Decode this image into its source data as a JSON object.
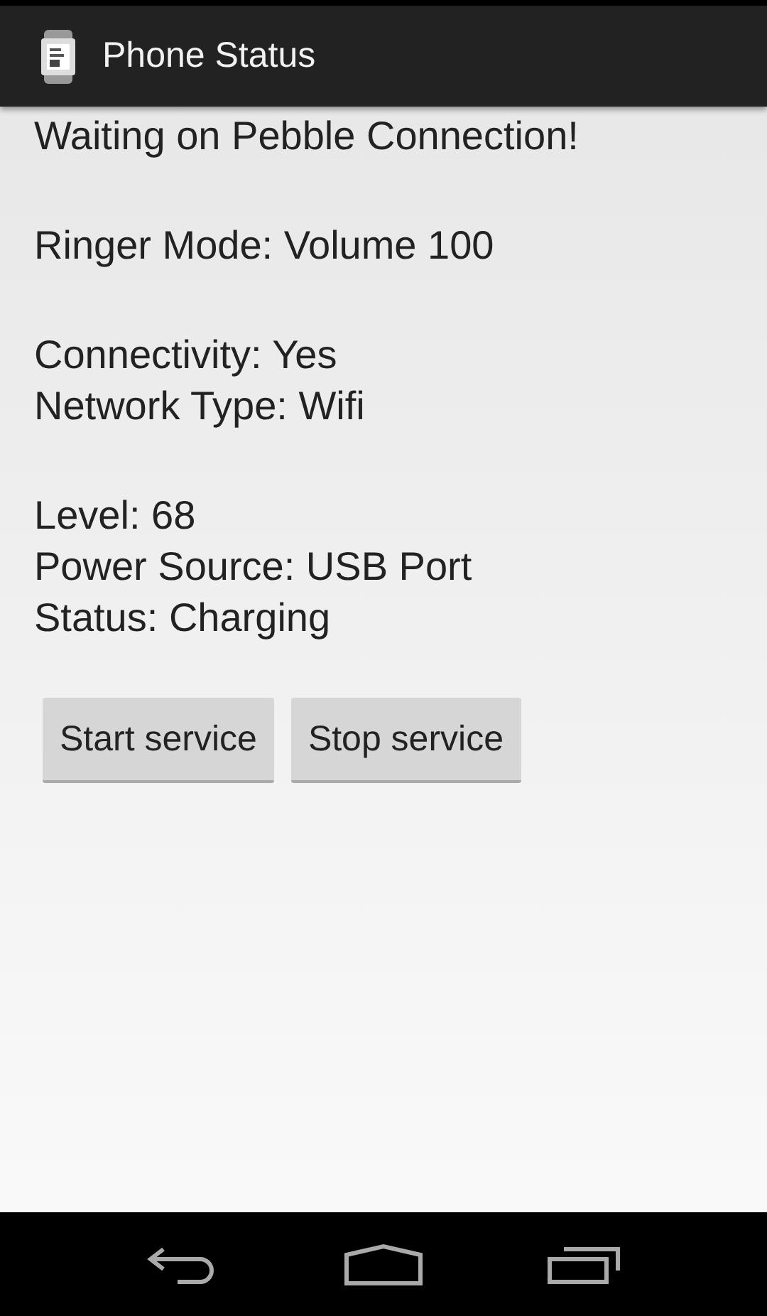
{
  "action_bar": {
    "title": "Phone Status"
  },
  "groups": [
    {
      "lines": [
        "Waiting on Pebble Connection!"
      ]
    },
    {
      "lines": [
        "Ringer Mode: Volume 100"
      ]
    },
    {
      "lines": [
        "Connectivity: Yes",
        "Network Type: Wifi"
      ]
    },
    {
      "lines": [
        "Level: 68",
        "Power Source: USB Port",
        "Status: Charging"
      ]
    }
  ],
  "buttons": [
    "Start service",
    "Stop service"
  ]
}
